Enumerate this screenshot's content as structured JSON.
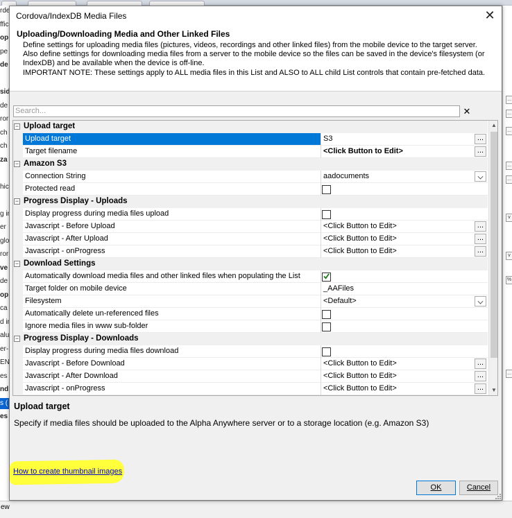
{
  "background_app": {
    "left_fragments": [
      {
        "text": "rdeb",
        "bold": false
      },
      {
        "text": "ffic",
        "bold": false
      },
      {
        "text": "op",
        "bold": true
      },
      {
        "text": "pe",
        "bold": false
      },
      {
        "text": "de",
        "bold": true
      },
      {
        "text": "",
        "bold": false
      },
      {
        "text": "sid",
        "bold": true
      },
      {
        "text": "de",
        "bold": false
      },
      {
        "text": "ror",
        "bold": false
      },
      {
        "text": "ch",
        "bold": false
      },
      {
        "text": "ch",
        "bold": false
      },
      {
        "text": "za",
        "bold": true
      },
      {
        "text": "",
        "bold": false
      },
      {
        "text": "hic",
        "bold": false
      },
      {
        "text": "",
        "bold": false
      },
      {
        "text": "g in",
        "bold": false
      },
      {
        "text": "er",
        "bold": false
      },
      {
        "text": "glo",
        "bold": false
      },
      {
        "text": "ror",
        "bold": false
      },
      {
        "text": "ve",
        "bold": true
      },
      {
        "text": "de",
        "bold": false
      },
      {
        "text": "op",
        "bold": true
      },
      {
        "text": "ca",
        "bold": false
      },
      {
        "text": "d in",
        "bold": false
      },
      {
        "text": "alu",
        "bold": false
      },
      {
        "text": "er-",
        "bold": false
      },
      {
        "text": "ENS",
        "bold": false
      },
      {
        "text": "es",
        "bold": false
      },
      {
        "text": "nd",
        "bold": true
      },
      {
        "text": "s (",
        "bold": false,
        "selected": true
      },
      {
        "text": "es",
        "bold": true
      }
    ],
    "right_fragments": [
      "...",
      "...",
      "...",
      "...",
      "...",
      "v",
      "v",
      "%",
      "..."
    ],
    "bottom_fragment": "ew"
  },
  "dialog": {
    "title": "Cordova/IndexDB Media Files",
    "close_label": "✕",
    "header": {
      "title": "Uploading/Downloading Media and Other Linked Files",
      "lines": [
        "Define settings for uploading media files (pictures, videos, recordings and other linked files) from the mobile device to the target server.",
        "Also define settings for downloading media files from a server to the mobile device so the files can be saved in the device's filesystem (or",
        "IndexDB) and be available when the device is off-line.",
        "IMPORTANT NOTE: These settings apply to ALL media files in this List and ALSO to ALL child List controls that contain pre-fetched data."
      ]
    },
    "search": {
      "placeholder": "Search...",
      "clear_label": "✕"
    },
    "grid": {
      "rows": [
        {
          "type": "cat",
          "label": "Upload target"
        },
        {
          "type": "prop",
          "name": "Upload target",
          "value": "S3",
          "editor": "ellipsis",
          "selected": true
        },
        {
          "type": "prop",
          "name": "Target filename",
          "value": "<Click Button to Edit>",
          "editor": "ellipsis",
          "bold": true
        },
        {
          "type": "cat",
          "label": "Amazon S3"
        },
        {
          "type": "prop",
          "name": "Connection String",
          "value": "aadocuments",
          "editor": "dropdown"
        },
        {
          "type": "prop",
          "name": "Protected read",
          "editor": "checkbox",
          "checked": false
        },
        {
          "type": "cat",
          "label": "Progress Display - Uploads"
        },
        {
          "type": "prop",
          "name": "Display progress during media files upload",
          "editor": "checkbox",
          "checked": false
        },
        {
          "type": "prop",
          "name": "Javascript - Before Upload",
          "value": "<Click Button to Edit>",
          "editor": "ellipsis"
        },
        {
          "type": "prop",
          "name": "Javascript - After Upload",
          "value": "<Click Button to Edit>",
          "editor": "ellipsis"
        },
        {
          "type": "prop",
          "name": "Javascript - onProgress",
          "value": "<Click Button to Edit>",
          "editor": "ellipsis"
        },
        {
          "type": "cat",
          "label": "Download Settings"
        },
        {
          "type": "prop",
          "name": "Automatically download media files and other linked files when populating the List",
          "editor": "checkbox",
          "checked": true
        },
        {
          "type": "prop",
          "name": "Target folder on mobile device",
          "value": "_AAFiles",
          "editor": "none"
        },
        {
          "type": "prop",
          "name": "Filesystem",
          "value": "<Default>",
          "editor": "dropdown"
        },
        {
          "type": "prop",
          "name": "Automatically delete un-referenced files",
          "editor": "checkbox",
          "checked": false
        },
        {
          "type": "prop",
          "name": "Ignore media files in www sub-folder",
          "editor": "checkbox",
          "checked": false
        },
        {
          "type": "cat",
          "label": "Progress Display - Downloads"
        },
        {
          "type": "prop",
          "name": "Display progress during media files download",
          "editor": "checkbox",
          "checked": false
        },
        {
          "type": "prop",
          "name": "Javascript - Before Download",
          "value": "<Click Button to Edit>",
          "editor": "ellipsis"
        },
        {
          "type": "prop",
          "name": "Javascript - After Download",
          "value": "<Click Button to Edit>",
          "editor": "ellipsis"
        },
        {
          "type": "prop",
          "name": "Javascript - onProgress",
          "value": "<Click Button to Edit>",
          "editor": "ellipsis"
        }
      ],
      "category_toggle": "−",
      "ellipsis_label": "...",
      "scroll_up": "▲",
      "scroll_down": "▼"
    },
    "description": {
      "title": "Upload target",
      "text": "Specify if media files should be uploaded to the Alpha Anywhere server or to a storage location (e.g. Amazon S3)"
    },
    "help_link": "How to create thumbnail images",
    "buttons": {
      "ok": "OK",
      "cancel": "Cancel"
    }
  },
  "colors": {
    "selection": "#0078d7",
    "link": "#0000cc",
    "highlighter": "#ffff3c",
    "checkmark": "#1f7a1f"
  }
}
